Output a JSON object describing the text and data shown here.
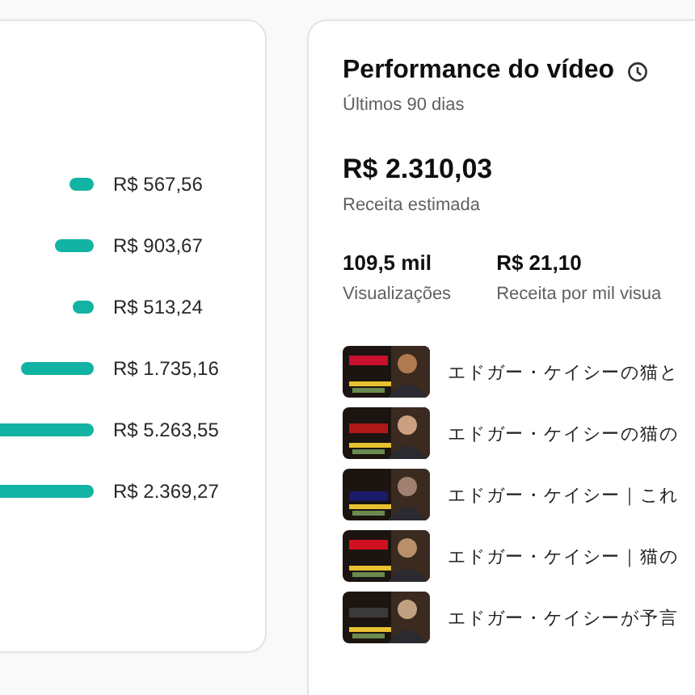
{
  "revenue_bars": [
    {
      "value": "R$ 567,56"
    },
    {
      "value": "R$ 903,67"
    },
    {
      "value": "R$ 513,24"
    },
    {
      "value": "R$ 1.735,16"
    },
    {
      "value": "R$ 5.263,55"
    },
    {
      "value": "R$ 2.369,27"
    }
  ],
  "performance": {
    "title": "Performance do vídeo",
    "subtitle": "Últimos 90 dias",
    "revenue": {
      "value": "R$ 2.310,03",
      "label": "Receita estimada"
    },
    "stats": [
      {
        "value": "109,5 mil",
        "label": "Visualizações"
      },
      {
        "value": "R$ 21,10",
        "label": "Receita por mil visua"
      }
    ],
    "videos": [
      {
        "title": "エドガー・ケイシーの猫と"
      },
      {
        "title": "エドガー・ケイシーの猫の"
      },
      {
        "title": "エドガー・ケイシー｜これ"
      },
      {
        "title": "エドガー・ケイシー｜猫の"
      },
      {
        "title": "エドガー・ケイシーが予言"
      }
    ]
  }
}
